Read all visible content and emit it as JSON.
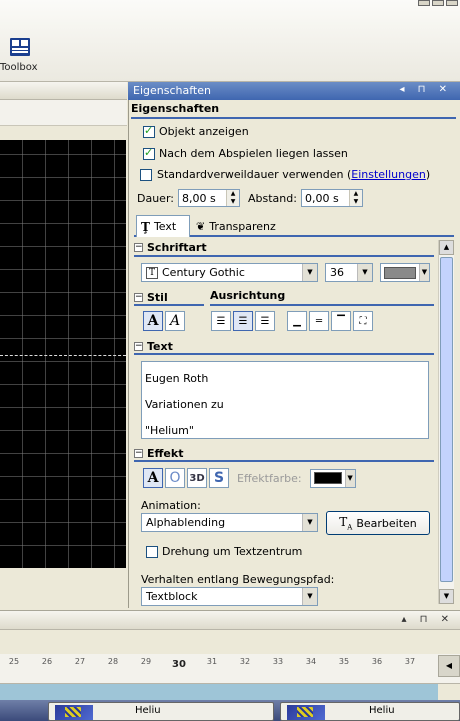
{
  "toolbar": {
    "toolbox_label": "Toolbox"
  },
  "left_panel": {
    "controls": "◂ ⊓ ✕"
  },
  "properties": {
    "title": "Eigenschaften",
    "controls": "◂ ⊓ ✕",
    "heading": "Eigenschaften",
    "show_object": {
      "label": "Objekt anzeigen",
      "checked": true
    },
    "keep_after_play": {
      "label": "Nach dem Abspielen liegen lassen",
      "checked": true
    },
    "default_duration": {
      "label": "Standardverweildauer verwenden (",
      "link": "Einstellungen",
      "suffix": ")",
      "checked": false
    },
    "duration": {
      "label": "Dauer:",
      "value": "8,00 s"
    },
    "spacing": {
      "label": "Abstand:",
      "value": "0,00 s"
    },
    "tabs": [
      {
        "label": "Text",
        "active": true
      },
      {
        "label": "Transparenz",
        "active": false
      }
    ],
    "font_section": {
      "title": "Schriftart",
      "font": "Century Gothic",
      "size": "36",
      "color": "#8a8a8a"
    },
    "style_section": {
      "title": "Stil",
      "alignment_title": "Ausrichtung"
    },
    "text_section": {
      "title": "Text",
      "lines": [
        "Eugen Roth",
        "Variationen zu",
        "\"Helium\""
      ]
    },
    "effect_section": {
      "title": "Effekt",
      "effect_color_label": "Effektfarbe:",
      "animation_label": "Animation:",
      "animation_value": "Alphablending",
      "edit_button": "Bearbeiten",
      "rotate_label": "Drehung um Textzentrum",
      "rotate_checked": false,
      "path_label": "Verhalten entlang Bewegungspfad:",
      "path_value": "Textblock"
    }
  },
  "timeline": {
    "controls": "▴ ⊓ ✕",
    "ruler": [
      "25",
      "26",
      "27",
      "28",
      "29",
      "30",
      "31",
      "32",
      "33",
      "34",
      "35",
      "36",
      "37"
    ],
    "clips": [
      {
        "label": "Heliu"
      },
      {
        "label": "Heliu"
      }
    ]
  },
  "colors": {
    "accent": "#3f66b0",
    "title_bar": "#4f74bc",
    "link": "#0000cc"
  }
}
